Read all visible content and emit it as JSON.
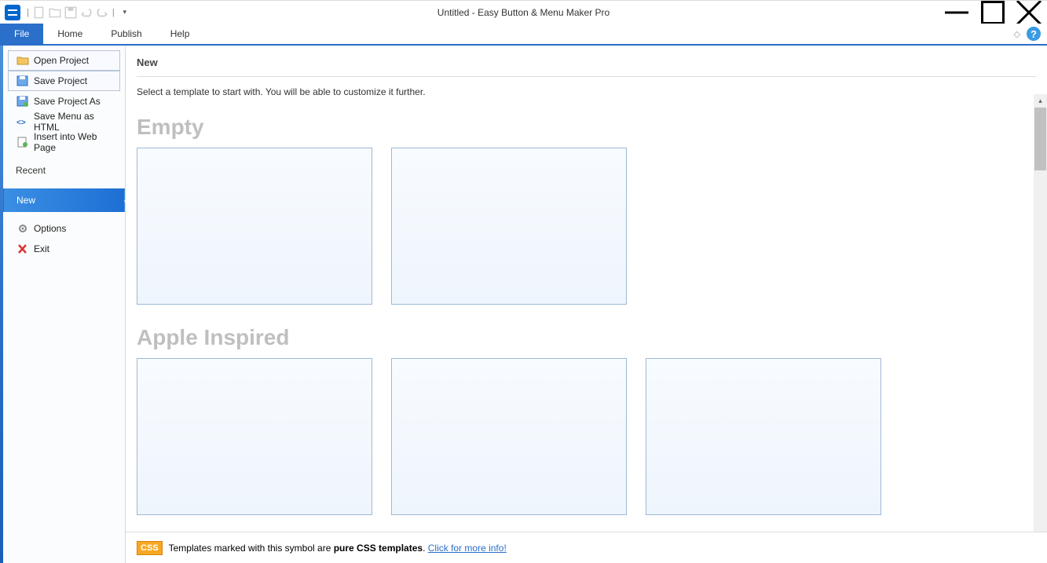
{
  "title": "Untitled - Easy Button & Menu Maker Pro",
  "ribbon": {
    "tabs": {
      "file": "File",
      "home": "Home",
      "publish": "Publish",
      "help": "Help"
    }
  },
  "sidebar": {
    "open_project": "Open Project",
    "save_project": "Save Project",
    "save_project_as": "Save Project As",
    "save_menu_html": "Save Menu as HTML",
    "insert_web": "Insert into Web Page",
    "recent": "Recent",
    "new": "New",
    "options": "Options",
    "exit": "Exit"
  },
  "content": {
    "header": "New",
    "desc": "Select a template to start with. You will be able to customize it further.",
    "sections": {
      "empty": "Empty",
      "apple": "Apple Inspired"
    }
  },
  "footer": {
    "badge": "CSS",
    "text1": "Templates marked with this symbol are ",
    "bold": "pure CSS templates",
    "text2": ". ",
    "link": "Click for more info!"
  }
}
